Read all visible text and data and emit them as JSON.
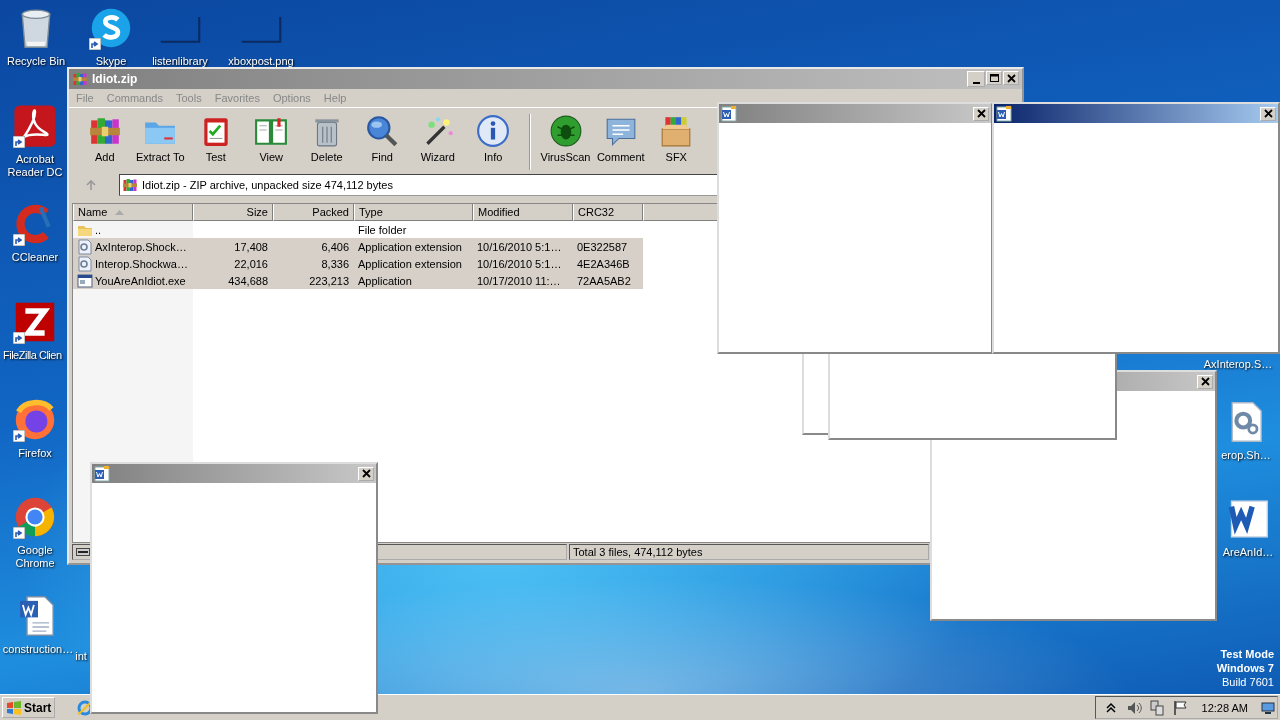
{
  "desktop": {
    "icons": [
      {
        "label": "Recycle Bin",
        "kind": "trash",
        "shortcut": false
      },
      {
        "label": "Skype",
        "kind": "skype",
        "shortcut": true
      },
      {
        "label": "listenlibrary",
        "kind": "thumbnail",
        "shortcut": false
      },
      {
        "label": "xboxpost.png",
        "kind": "thumbnail",
        "shortcut": false
      },
      {
        "label": "Acrobat Reader DC",
        "kind": "acrobat",
        "shortcut": true
      },
      {
        "label": "CCleaner",
        "kind": "ccleaner",
        "shortcut": true
      },
      {
        "label": "FileZilla Clien",
        "kind": "filezilla",
        "shortcut": true
      },
      {
        "label": "Firefox",
        "kind": "firefox",
        "shortcut": true
      },
      {
        "label": "Google Chrome",
        "kind": "chrome",
        "shortcut": true
      },
      {
        "label": "construction…",
        "kind": "word",
        "shortcut": false
      },
      {
        "label": "int",
        "kind": "hidden"
      },
      {
        "label": "AxInterop.S…",
        "kind": "hidden"
      },
      {
        "label": "erop.Sh…",
        "kind": "gear",
        "shortcut": false
      },
      {
        "label": "AreAnId…",
        "kind": "wordbig",
        "shortcut": false
      }
    ]
  },
  "archive_window": {
    "title": "Idiot.zip",
    "menu": [
      "File",
      "Commands",
      "Tools",
      "Favorites",
      "Options",
      "Help"
    ],
    "toolbar": [
      {
        "label": "Add",
        "kind": "add",
        "separator_before": false
      },
      {
        "label": "Extract To",
        "kind": "extract",
        "separator_before": false
      },
      {
        "label": "Test",
        "kind": "test",
        "separator_before": false
      },
      {
        "label": "View",
        "kind": "view",
        "separator_before": false
      },
      {
        "label": "Delete",
        "kind": "delete",
        "separator_before": false
      },
      {
        "label": "Find",
        "kind": "find",
        "separator_before": false
      },
      {
        "label": "Wizard",
        "kind": "wizard",
        "separator_before": false
      },
      {
        "label": "Info",
        "kind": "info",
        "separator_before": false
      },
      {
        "label": "VirusScan",
        "kind": "virus",
        "separator_before": true
      },
      {
        "label": "Comment",
        "kind": "comment",
        "separator_before": false
      },
      {
        "label": "SFX",
        "kind": "sfx",
        "separator_before": false
      }
    ],
    "address": "Idiot.zip - ZIP archive, unpacked size 474,112 bytes",
    "columns": [
      "Name",
      "Size",
      "Packed",
      "Type",
      "Modified",
      "CRC32"
    ],
    "rows": [
      {
        "kind": "folder",
        "selected": false,
        "cells": [
          "..",
          "",
          "",
          "File folder",
          "",
          ""
        ]
      },
      {
        "kind": "dll",
        "selected": true,
        "cells": [
          "AxInterop.Shock…",
          "17,408",
          "6,406",
          "Application extension",
          "10/16/2010 5:1…",
          "0E322587"
        ]
      },
      {
        "kind": "dll",
        "selected": true,
        "cells": [
          "Interop.Shockwa…",
          "22,016",
          "8,336",
          "Application extension",
          "10/16/2010 5:1…",
          "4E2A346B"
        ]
      },
      {
        "kind": "exe",
        "selected": true,
        "cells": [
          "YouAreAnIdiot.exe",
          "434,688",
          "223,213",
          "Application",
          "10/17/2010 11:…",
          "72AA5AB2"
        ]
      }
    ],
    "status": "Total 3 files, 474,112 bytes"
  },
  "popups": [
    {
      "kind": "close_only",
      "active": false
    },
    {
      "kind": "plain"
    },
    {
      "kind": "plain"
    },
    {
      "kind": "titled",
      "active": false
    },
    {
      "kind": "titled",
      "active": true
    },
    {
      "kind": "titled",
      "active": false
    }
  ],
  "os_notice": [
    "Test Mode",
    "Windows 7",
    "Build 7601"
  ],
  "taskbar": {
    "start": "Start",
    "clock": "12:28 AM"
  }
}
